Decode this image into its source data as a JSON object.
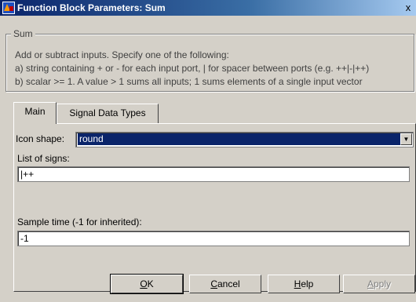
{
  "window": {
    "title": "Function Block Parameters: Sum",
    "close_glyph": "x"
  },
  "group": {
    "legend": "Sum",
    "lines": [
      "Add or subtract inputs.  Specify one of the following:",
      "a) string containing + or - for each input port, | for spacer between ports (e.g. ++|-|++)",
      "b) scalar >= 1. A value > 1 sums all inputs; 1 sums elements of a single input vector"
    ]
  },
  "tabs": [
    {
      "label": "Main",
      "active": true
    },
    {
      "label": "Signal Data Types",
      "active": false
    }
  ],
  "fields": {
    "icon_shape": {
      "label": "Icon shape:",
      "value": "round",
      "options": [
        "round"
      ]
    },
    "signs": {
      "label": "List of signs:",
      "value": "|++"
    },
    "sample_time": {
      "label": "Sample time (-1 for inherited):",
      "value": "-1"
    }
  },
  "buttons": {
    "ok": {
      "prefix": "",
      "mnemonic": "O",
      "rest": "K"
    },
    "cancel": {
      "prefix": "",
      "mnemonic": "C",
      "rest": "ancel"
    },
    "help": {
      "prefix": "",
      "mnemonic": "H",
      "rest": "elp"
    },
    "apply": {
      "prefix": "",
      "mnemonic": "A",
      "rest": "pply",
      "disabled": true
    }
  },
  "icons": {
    "app": "simulink-block-icon",
    "dropdown": "chevron-down-icon"
  }
}
